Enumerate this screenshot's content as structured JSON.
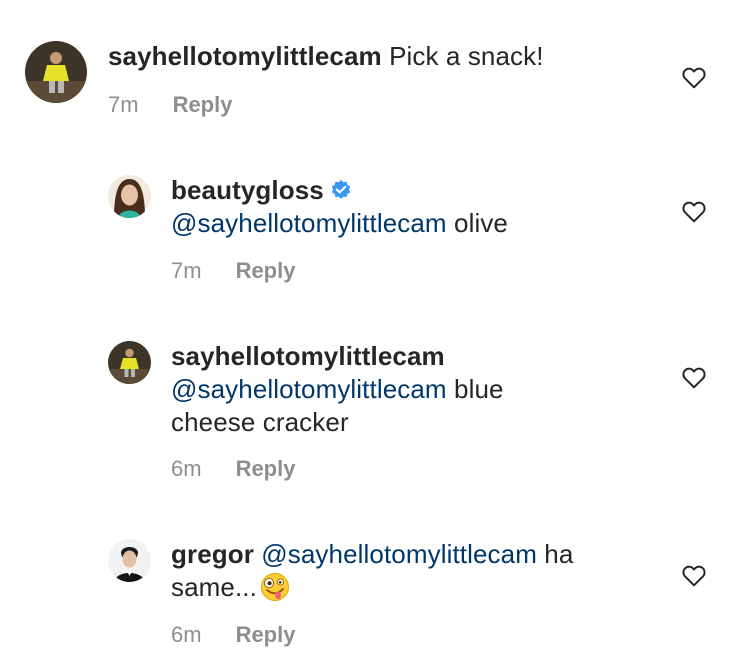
{
  "comments": [
    {
      "username": "sayhellotomylittlecam",
      "text": "Pick a snack!",
      "time": "7m",
      "reply_label": "Reply"
    },
    {
      "username": "beautygloss",
      "verified": true,
      "mention": "@sayhellotomylittlecam",
      "text": "olive",
      "time": "7m",
      "reply_label": "Reply"
    },
    {
      "username": "sayhellotomylittlecam",
      "mention": "@sayhellotomylittlecam",
      "text_line1": "blue",
      "text_line2": "cheese cracker",
      "time": "6m",
      "reply_label": "Reply"
    },
    {
      "username": "gregor",
      "mention": "@sayhellotomylittlecam",
      "text_line1": "ha",
      "text_line2": "same...",
      "emoji": "zany-face",
      "time": "6m",
      "reply_label": "Reply"
    }
  ],
  "colors": {
    "text": "#262626",
    "mention": "#00376b",
    "meta": "#8e8e8e",
    "verified": "#3897f0"
  }
}
